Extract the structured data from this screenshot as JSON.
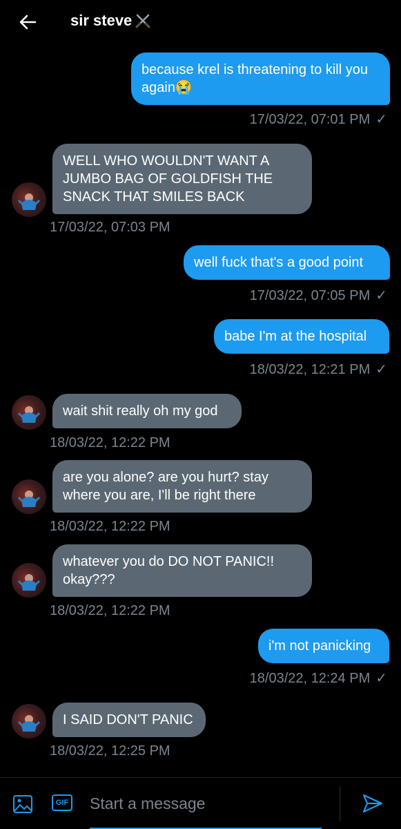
{
  "header": {
    "title": "sir steve",
    "title_emoji": "crossed-swords-emoji"
  },
  "messages": [
    {
      "type": "sent",
      "text": "because krel is threatening to kill you again😭",
      "timestamp": "17/03/22, 07:01 PM",
      "status": "✓"
    },
    {
      "type": "received",
      "text": "WELL WHO WOULDN'T WANT A JUMBO BAG OF GOLDFISH THE SNACK THAT SMILES BACK",
      "timestamp": "17/03/22, 07:03 PM"
    },
    {
      "type": "sent",
      "text": "well fuck that's a good point",
      "timestamp": "17/03/22, 07:05 PM",
      "status": "✓"
    },
    {
      "type": "sent",
      "text": "babe I'm at the hospital",
      "timestamp": "18/03/22, 12:21 PM",
      "status": "✓"
    },
    {
      "type": "received",
      "text": "wait shit really oh my god",
      "timestamp": "18/03/22, 12:22 PM"
    },
    {
      "type": "received",
      "text": "are you alone? are you hurt? stay where you are, I'll be right there",
      "timestamp": "18/03/22, 12:22 PM"
    },
    {
      "type": "received",
      "text": "whatever you do DO NOT PANIC!! okay???",
      "timestamp": "18/03/22, 12:22 PM"
    },
    {
      "type": "sent",
      "text": "i'm not panicking",
      "timestamp": "18/03/22, 12:24 PM",
      "status": "✓"
    },
    {
      "type": "received",
      "text": "I SAID DON'T PANIC",
      "timestamp": "18/03/22, 12:25 PM"
    }
  ],
  "compose": {
    "placeholder": "Start a message",
    "gif_label": "GIF"
  },
  "colors": {
    "accent": "#1d9bf0",
    "received_bubble": "#5b6874",
    "timestamp": "#7b858f",
    "background": "#000000"
  }
}
